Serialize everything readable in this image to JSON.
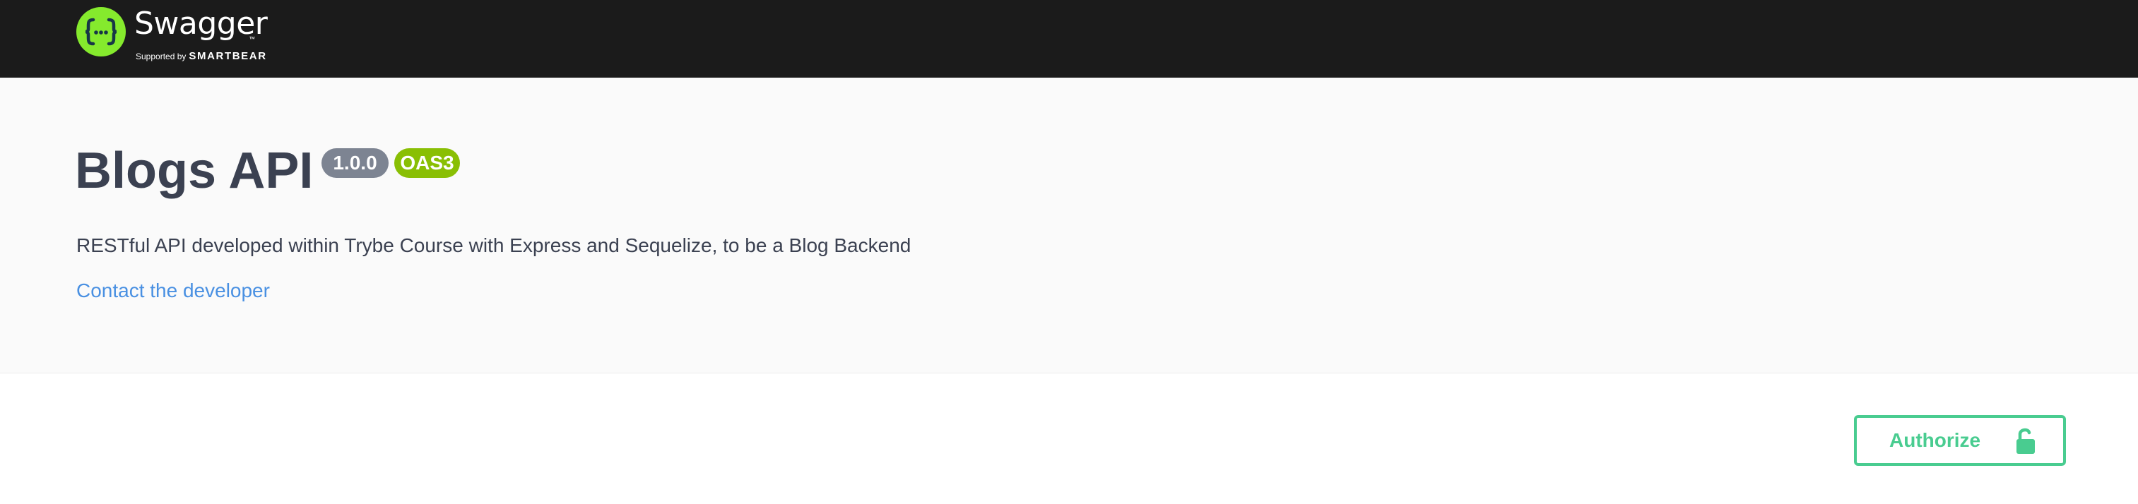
{
  "header": {
    "brand_name": "Swagger",
    "trademark": "™",
    "supported_by_label": "Supported by",
    "sponsor_name": "SMARTBEAR",
    "logo_icon": "swagger-logo-icon",
    "background_color": "#1b1b1b",
    "logo_color": "#85ea2d"
  },
  "info": {
    "title": "Blogs API",
    "version": "1.0.0",
    "oas_badge": "OAS3",
    "description": "RESTful API developed within Trybe Course with Express and Sequelize, to be a Blog Backend",
    "contact_link": "Contact the developer",
    "colors": {
      "title": "#3b4151",
      "version_badge": "#7d8492",
      "oas_badge": "#89bf04",
      "link": "#4990e2"
    }
  },
  "toolbar": {
    "authorize_label": "Authorize",
    "authorize_icon": "lock-open-icon",
    "accent_color": "#49cc90"
  }
}
